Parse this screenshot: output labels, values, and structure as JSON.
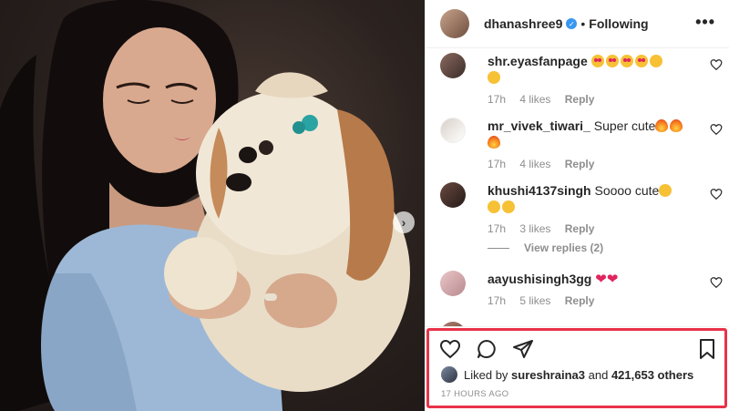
{
  "header": {
    "username": "dhanashree9",
    "verified_mark": "✓",
    "separator": "•",
    "follow_state": "Following",
    "more_label": "•••"
  },
  "comments": [
    {
      "user": "shr.eyasfanpage",
      "text": "",
      "emojis": [
        "heart-eyes",
        "heart-eyes",
        "heart-eyes",
        "heart-eyes",
        "laughing",
        "laughing"
      ],
      "time": "17h",
      "likes": "4 likes",
      "reply": "Reply"
    },
    {
      "user": "mr_vivek_tiwari_",
      "text": "Super cute",
      "emojis": [
        "fire",
        "fire",
        "fire"
      ],
      "time": "17h",
      "likes": "4 likes",
      "reply": "Reply"
    },
    {
      "user": "khushi4137singh",
      "text": "Soooo cute",
      "emojis": [
        "yum",
        "yum",
        "yum"
      ],
      "time": "17h",
      "likes": "3 likes",
      "reply": "Reply"
    },
    {
      "user": "aayushisingh3gg",
      "text": "",
      "emojis": [
        "red-heart",
        "red-heart"
      ],
      "time": "17h",
      "likes": "5 likes",
      "reply": "Reply"
    }
  ],
  "view_replies": "View replies (2)",
  "actions": {
    "like_icon": "heart-outline-icon",
    "comment_icon": "comment-bubble-icon",
    "share_icon": "paper-plane-icon",
    "save_icon": "bookmark-icon"
  },
  "likes": {
    "prefix": "Liked by",
    "user": "sureshraina3",
    "joiner": "and",
    "count_text": "421,653 others"
  },
  "timestamp": "17 HOURS AGO",
  "colors": {
    "highlight": "#e8324a",
    "verified": "#3897f0",
    "secondary_text": "#8e8e8e"
  }
}
